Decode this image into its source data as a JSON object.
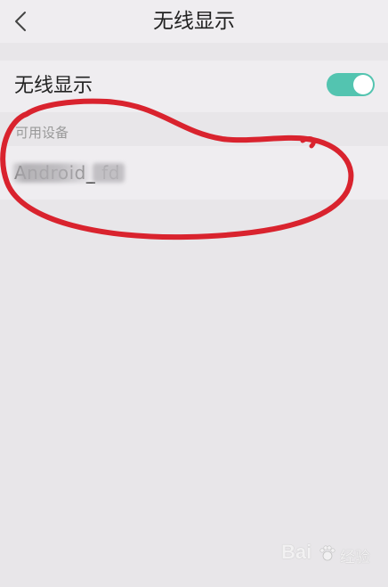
{
  "header": {
    "title": "无线显示",
    "back_icon": "chevron-left-icon"
  },
  "wireless_display_setting": {
    "label": "无线显示",
    "enabled": true,
    "toggle_color": "#53c4b0"
  },
  "available_devices": {
    "section_label": "可用设备",
    "items": [
      {
        "name": "Android_    fd"
      }
    ]
  },
  "annotation_color": "#d9232e",
  "watermark": {
    "text": "Bai",
    "sub": "经验"
  }
}
